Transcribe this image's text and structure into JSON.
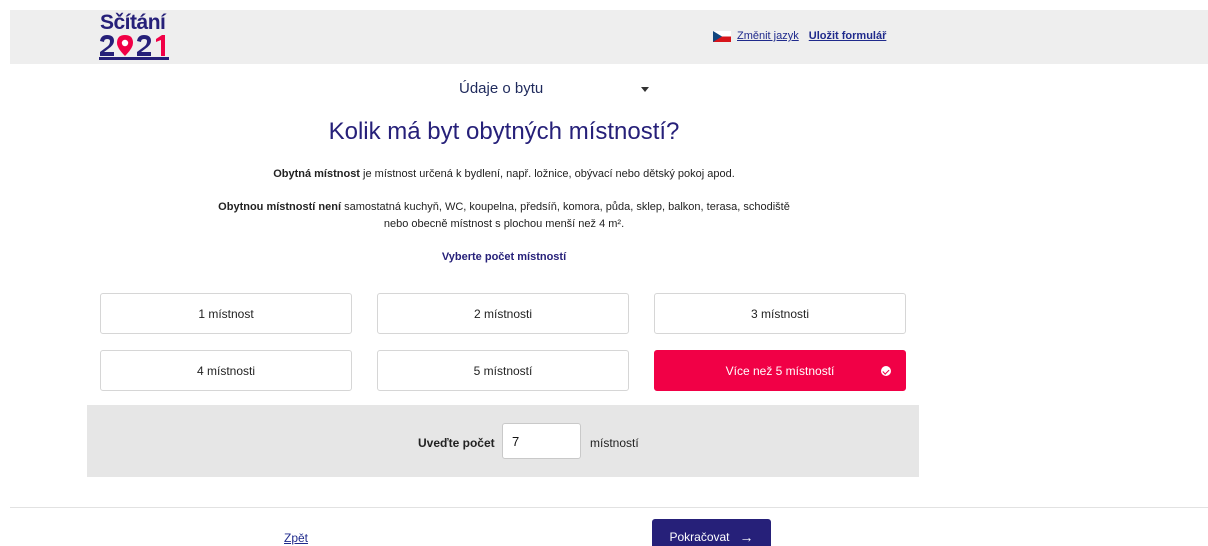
{
  "header": {
    "logo_title": "Sčítání",
    "logo_year": "2021",
    "change_language": "Změnit jazyk",
    "save_form": "Uložit formulář",
    "flag": "czech-flag-icon"
  },
  "section_select": {
    "value": "Údaje o bytu"
  },
  "question": {
    "title": "Kolik má byt obytných místností?",
    "desc1_bold": "Obytná místnost",
    "desc1_rest": " je místnost určená k bydlení, např. ložnice, obývací nebo dětský pokoj apod.",
    "desc2_bold": "Obytnou místností není",
    "desc2_rest": " samostatná kuchyň, WC, koupelna, předsíň, komora, půda, sklep, balkon, terasa, schodiště",
    "desc2_line2": "nebo obecně místnost s plochou menší než 4 m².",
    "prompt": "Vyberte počet místností"
  },
  "options": [
    {
      "label": "1 místnost"
    },
    {
      "label": "2 místnosti"
    },
    {
      "label": "3 místnosti"
    },
    {
      "label": "4 místnosti"
    },
    {
      "label": "5 místností"
    },
    {
      "label": "Více než 5 místností",
      "selected": true
    }
  ],
  "count": {
    "label": "Uveďte počet",
    "value": "7",
    "unit": "místností"
  },
  "footer": {
    "back": "Zpět",
    "next": "Pokračovat",
    "next_icon": "arrow-right-icon"
  },
  "colors": {
    "brand_blue": "#262079",
    "accent_red": "#f10046",
    "header_bg": "#eeeeee",
    "panel_bg": "#e6e6e6"
  }
}
